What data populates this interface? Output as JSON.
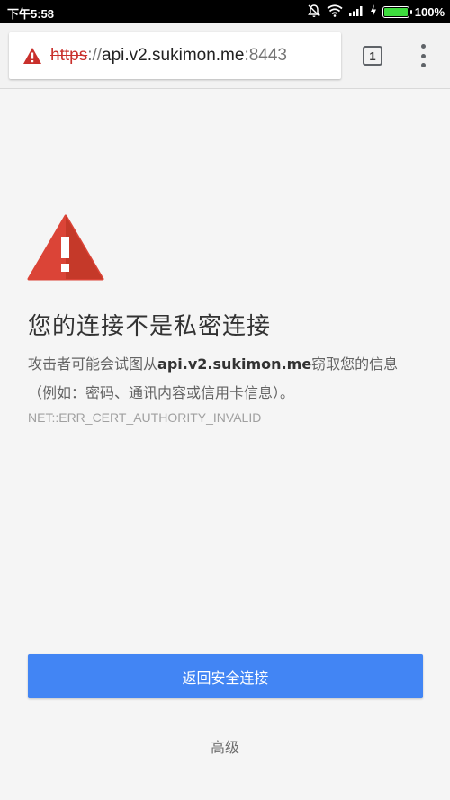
{
  "status_bar": {
    "time": "下午5:58",
    "battery_percent": "100%",
    "battery_level": 1.0,
    "icons": [
      "alarm-off-icon",
      "wifi-icon",
      "signal-icon",
      "charging-icon",
      "battery-icon"
    ]
  },
  "toolbar": {
    "url": {
      "scheme": "https",
      "separator": "://",
      "host": "api.v2.sukimon.me",
      "port": ":8443"
    },
    "security_icon": "warning-triangle-icon",
    "tab_count": "1",
    "menu_icon": "more-vert-icon"
  },
  "interstitial": {
    "icon": "warning-triangle-icon",
    "heading": "您的连接不是私密连接",
    "explanation": {
      "before": "攻击者可能会试图从",
      "host": "api.v2.sukimon.me",
      "after": "窃取您的信息（例如：密码、通讯内容或信用卡信息）。"
    },
    "error_code": "NET::ERR_CERT_AUTHORITY_INVALID",
    "primary_button": "返回安全连接",
    "advanced_link": "高级"
  },
  "colors": {
    "accent": "#4285f4",
    "warning_red": "#db4437",
    "url_scheme_red": "#c9302c",
    "background": "#f5f5f5"
  }
}
